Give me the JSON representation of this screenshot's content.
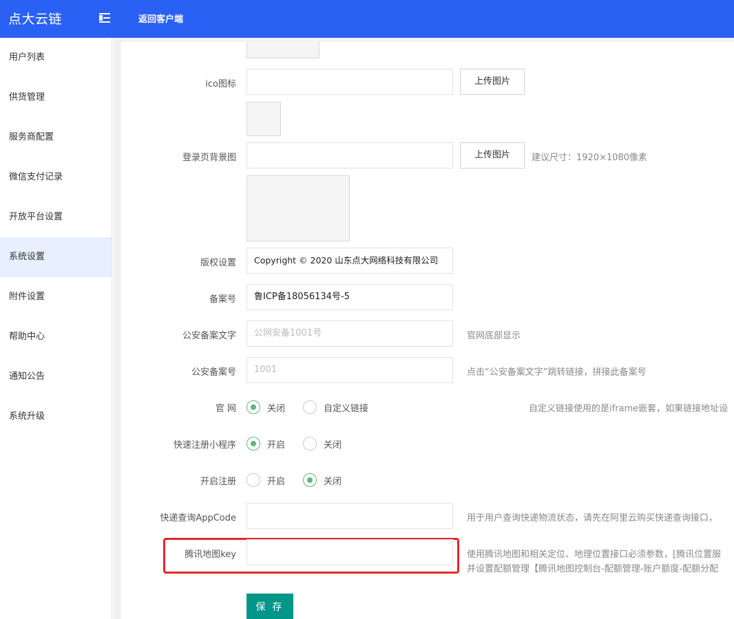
{
  "header": {
    "brand": "点大云链",
    "menu_icon": "indent-icon",
    "back_label": "返回客户端",
    "bg_color": "#2a61f5"
  },
  "sidebar": {
    "items": [
      {
        "label": "用户列表"
      },
      {
        "label": "供货管理"
      },
      {
        "label": "服务商配置"
      },
      {
        "label": "微信支付记录"
      },
      {
        "label": "开放平台设置"
      },
      {
        "label": "系统设置",
        "active": true
      },
      {
        "label": "附件设置"
      },
      {
        "label": "帮助中心"
      },
      {
        "label": "通知公告"
      },
      {
        "label": "系统升级"
      }
    ]
  },
  "form": {
    "ico": {
      "label": "ico图标",
      "value": "",
      "upload_label": "上传图片"
    },
    "login_bg": {
      "label": "登录页背景图",
      "value": "",
      "upload_label": "上传图片",
      "hint": "建议尺寸：1920×1080像素"
    },
    "copyright": {
      "label": "版权设置",
      "value": "Copyright © 2020 山东点大网络科技有限公司"
    },
    "icp": {
      "label": "备案号",
      "value": "鲁ICP备18056134号-5"
    },
    "police_text": {
      "label": "公安备案文字",
      "placeholder": "公网安备1001号",
      "hint": "官网底部显示"
    },
    "police_no": {
      "label": "公安备案号",
      "placeholder": "1001",
      "hint": "点击“公安备案文字”跳转链接，拼接此备案号"
    },
    "website": {
      "label": "官 网",
      "options": [
        "关闭",
        "自定义链接"
      ],
      "selected": "关闭",
      "hint": "自定义链接使用的是iframe嵌套，如果链接地址设"
    },
    "quick_register": {
      "label": "快速注册小程序",
      "options": [
        "开启",
        "关闭"
      ],
      "selected": "开启"
    },
    "open_register": {
      "label": "开启注册",
      "options": [
        "开启",
        "关闭"
      ],
      "selected": "关闭"
    },
    "express_appcode": {
      "label": "快递查询AppCode",
      "value": "",
      "hint": "用于用户查询快递物流状态，请先在阿里云购买快递查询接口，"
    },
    "tencent_map_key": {
      "label": "腾讯地图key",
      "value": "",
      "hint_line1": "使用腾讯地图和相关定位、地理位置接口必须参数，[腾讯位置服",
      "hint_line2": "并设置配额管理【腾讯地图控制台-配额管理-账户额度-配额分配"
    },
    "save_label": "保 存",
    "highlight_color": "#e8262a",
    "save_color": "#009688",
    "radio_color": "#5fb878"
  }
}
